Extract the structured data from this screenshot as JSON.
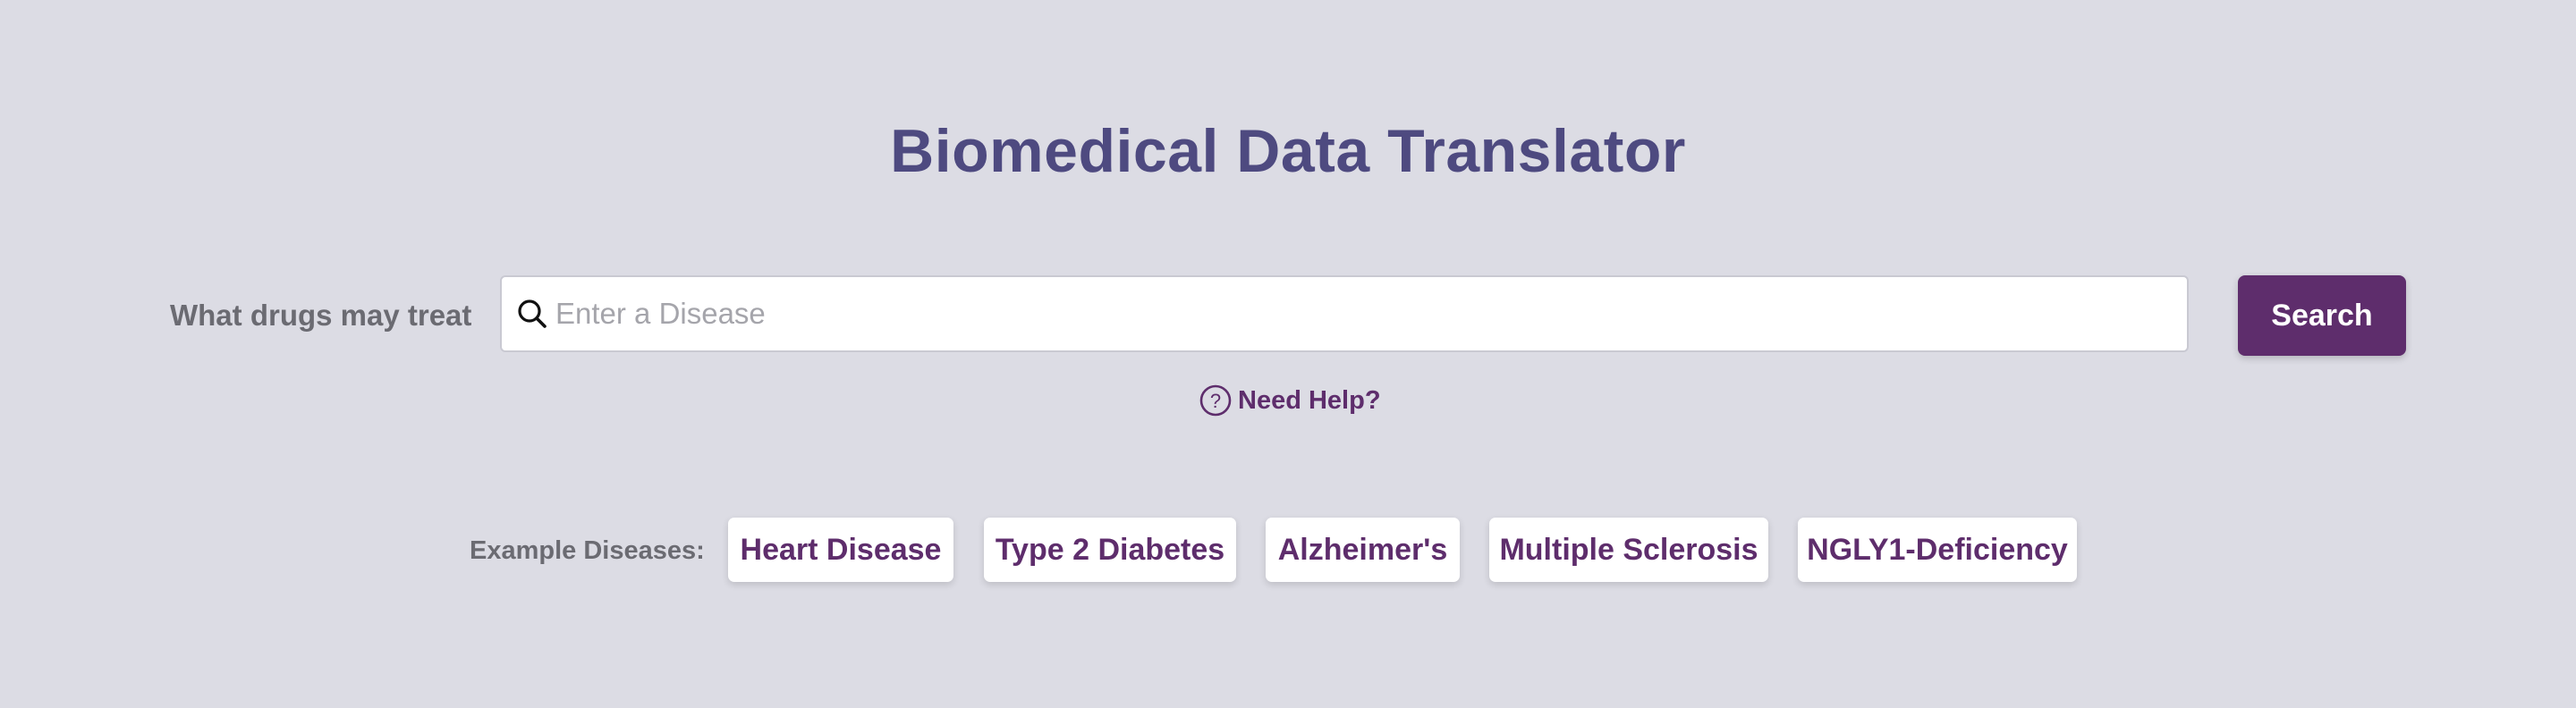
{
  "header": {
    "title": "Biomedical Data Translator"
  },
  "search": {
    "label": "What drugs may treat",
    "placeholder": "Enter a Disease",
    "value": "",
    "button_label": "Search",
    "icon": "search-icon"
  },
  "help": {
    "label": "Need Help?",
    "icon": "question-circle-icon"
  },
  "examples": {
    "label": "Example Diseases:",
    "items": [
      {
        "label": "Heart Disease"
      },
      {
        "label": "Type 2 Diabetes"
      },
      {
        "label": "Alzheimer's"
      },
      {
        "label": "Multiple Sclerosis"
      },
      {
        "label": "NGLY1-Deficiency"
      }
    ]
  },
  "colors": {
    "background": "#dcdce4",
    "title": "#4e4a80",
    "accent": "#5e2d6c",
    "label": "#6b6b72"
  }
}
